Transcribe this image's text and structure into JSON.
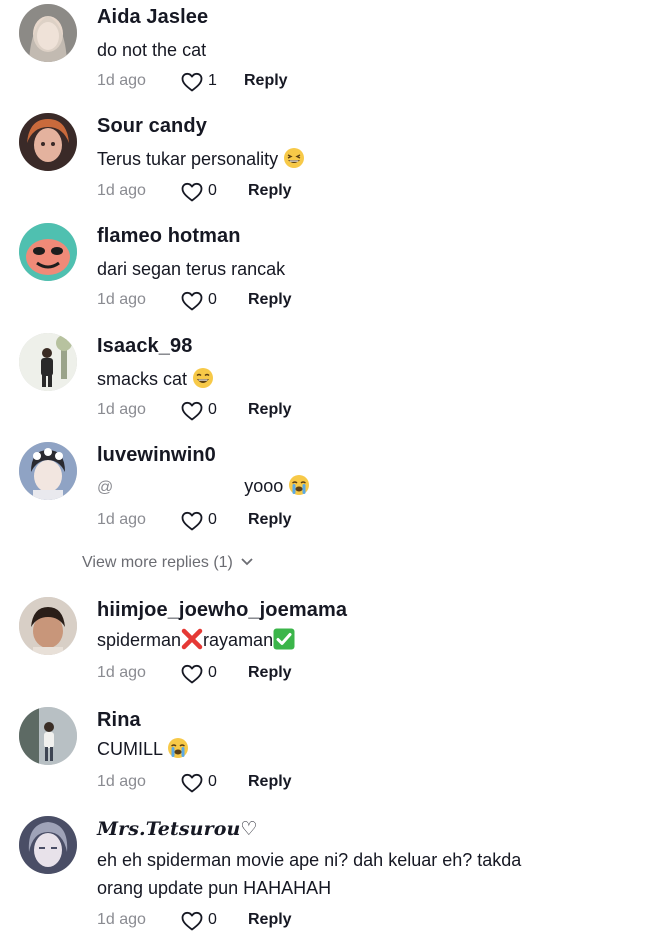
{
  "comments": [
    {
      "username": "Aida Jaslee",
      "text": "do not the cat",
      "time": "1d ago",
      "likes": "1",
      "reply": "Reply"
    },
    {
      "username": "Sour candy",
      "text": "Terus tukar personality",
      "time": "1d ago",
      "likes": "0",
      "reply": "Reply"
    },
    {
      "username": "flameo hotman",
      "text": "dari segan terus rancak",
      "time": "1d ago",
      "likes": "0",
      "reply": "Reply"
    },
    {
      "username": "Isaack_98",
      "text": "smacks cat",
      "time": "1d ago",
      "likes": "0",
      "reply": "Reply"
    },
    {
      "username": "luvewinwin0",
      "mention": "@",
      "text": "yooo",
      "time": "1d ago",
      "likes": "0",
      "reply": "Reply"
    },
    {
      "username": "hiimjoe_joewho_joemama",
      "text_a": "spiderman",
      "text_b": "rayaman",
      "time": "1d ago",
      "likes": "0",
      "reply": "Reply"
    },
    {
      "username": "Rina",
      "text": "CUMILL",
      "time": "1d ago",
      "likes": "0",
      "reply": "Reply"
    },
    {
      "username": "Mrs.Tetsurou♡",
      "text": "eh eh spiderman movie ape ni? dah keluar eh? takda orang update pun HAHAHAH",
      "time": "1d ago",
      "likes": "0",
      "reply": "Reply"
    }
  ],
  "view_more": "View more replies (1)",
  "icons": {
    "like": "heart-outline-icon",
    "expand": "chevron-down-icon",
    "emoji_grin": "grinning-squinting-face-emoji",
    "emoji_laugh": "laughing-face-emoji",
    "emoji_cry": "loudly-crying-face-emoji",
    "emoji_cross": "cross-mark-emoji",
    "emoji_check": "check-mark-button-emoji"
  },
  "colors": {
    "text_primary": "#161823",
    "text_secondary": "#8a8b91",
    "check_green": "#3bb54a",
    "cross_red": "#e53935"
  }
}
